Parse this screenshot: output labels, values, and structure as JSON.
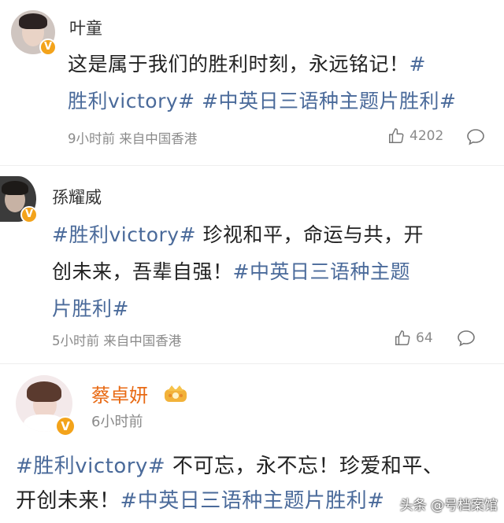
{
  "posts": [
    {
      "name": "叶童",
      "text_plain": "这是属于我们的胜利时刻，永远铭记！",
      "tag1": "#胜利victory#",
      "tag2": "#中英日三语种主题片胜利#",
      "meta": "9小时前 来自中国香港",
      "likes": "4202"
    },
    {
      "name": "孫耀威",
      "tag1": "#胜利victory#",
      "text_plain": " 珍视和平，命运与共，开",
      "text_plain2": "创未来，吾辈自强！",
      "tag2a": "#中英日三语种主题",
      "tag2b": "片胜利#",
      "meta": "5小时前 来自中国香港",
      "likes": "64"
    },
    {
      "name": "蔡卓妍",
      "time": "6小时前",
      "tag1": "#胜利victory#",
      "text_plain": " 不可忘，永不忘！珍爱和平、",
      "text_plain2": "开创未来！",
      "tag2": "#中英日三语种主题片胜利#"
    }
  ],
  "watermark": "头条 @号档案馆",
  "colors": {
    "tag": "#4a6a9a",
    "name_vip": "#e86a14",
    "badge": "#f3a31b"
  }
}
